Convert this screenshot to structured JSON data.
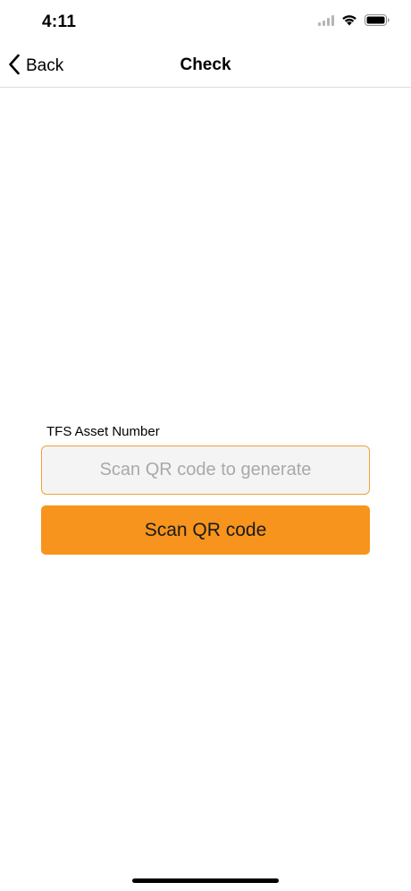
{
  "status_bar": {
    "time": "4:11"
  },
  "nav": {
    "back_label": "Back",
    "title": "Check"
  },
  "form": {
    "label": "TFS Asset Number",
    "input_value": "",
    "input_placeholder": "Scan QR code to generate",
    "scan_button_label": "Scan QR code"
  },
  "colors": {
    "accent": "#f7941d",
    "input_border": "#f0a23a",
    "input_background": "#f4f4f4"
  },
  "icons": {
    "back": "chevron-left-icon",
    "signal": "cellular-signal-icon",
    "wifi": "wifi-icon",
    "battery": "battery-icon"
  }
}
